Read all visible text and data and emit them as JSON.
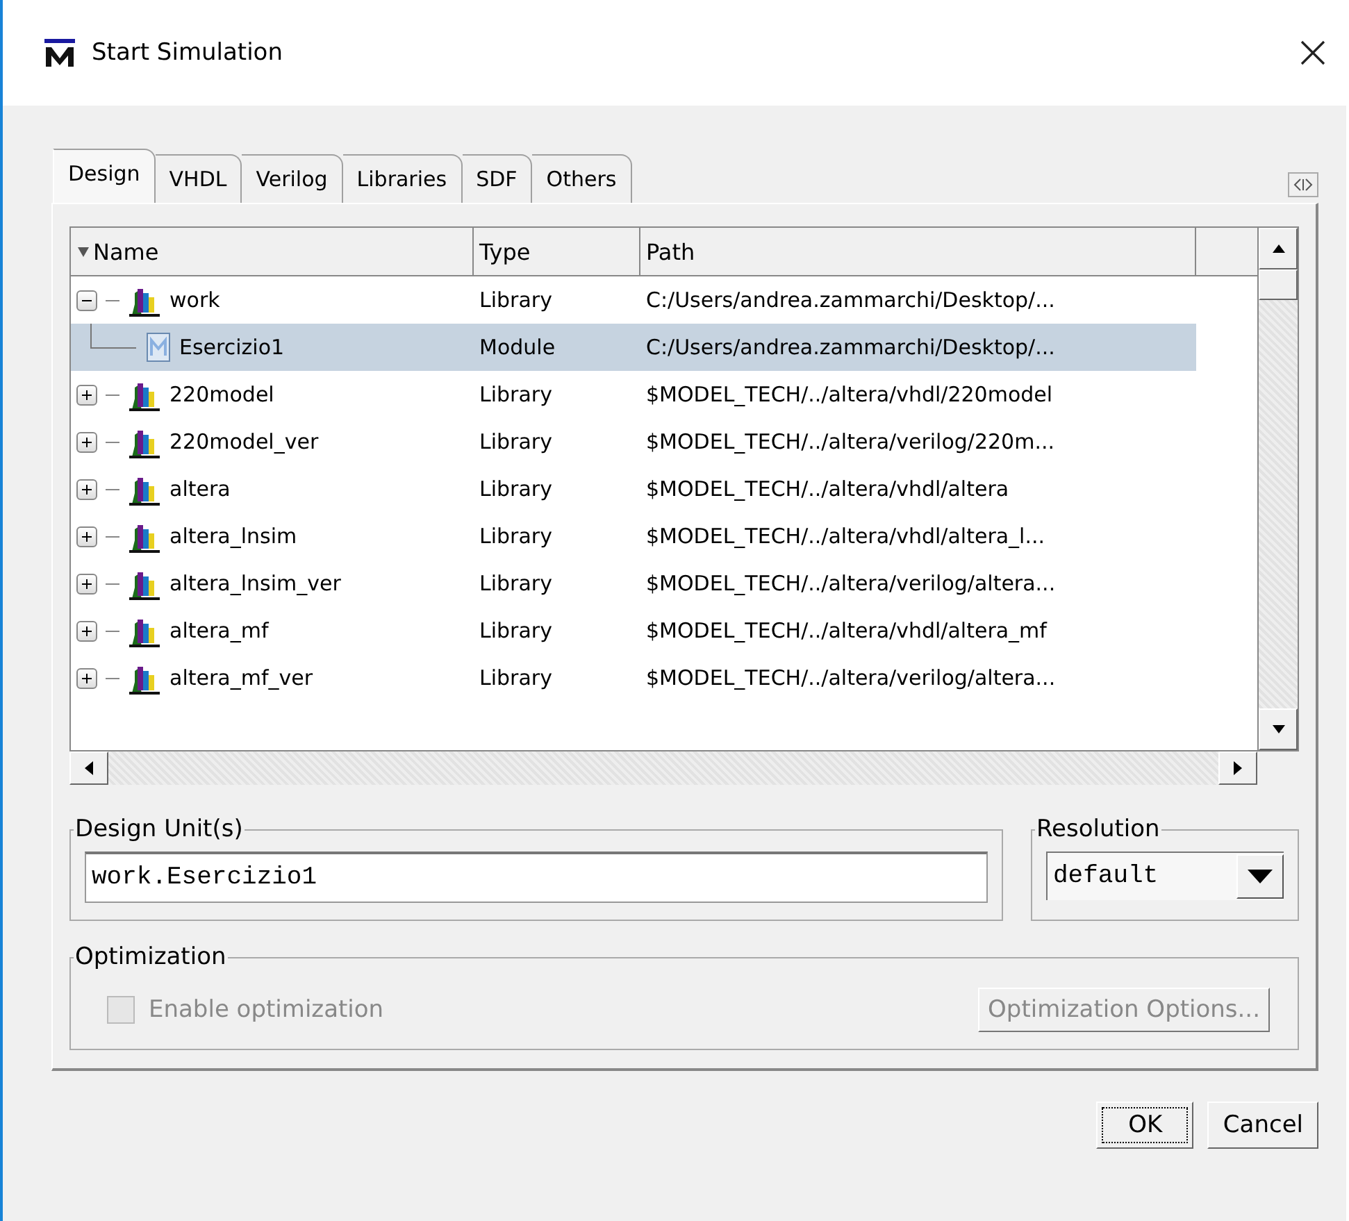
{
  "window": {
    "title": "Start Simulation"
  },
  "tabs": [
    {
      "label": "Design",
      "selected": true
    },
    {
      "label": "VHDL",
      "selected": false
    },
    {
      "label": "Verilog",
      "selected": false
    },
    {
      "label": "Libraries",
      "selected": false
    },
    {
      "label": "SDF",
      "selected": false
    },
    {
      "label": "Others",
      "selected": false
    }
  ],
  "tree": {
    "columns": [
      "Name",
      "Type",
      "Path"
    ],
    "rows": [
      {
        "kind": "library",
        "name": "work",
        "type": "Library",
        "path": "C:/Users/andrea.zammarchi/Desktop/...",
        "expanded": true,
        "selected": false,
        "children": [
          {
            "kind": "module",
            "name": "Esercizio1",
            "type": "Module",
            "path": "C:/Users/andrea.zammarchi/Desktop/...",
            "selected": true
          }
        ]
      },
      {
        "kind": "library",
        "name": "220model",
        "type": "Library",
        "path": "$MODEL_TECH/../altera/vhdl/220model",
        "expanded": false,
        "selected": false
      },
      {
        "kind": "library",
        "name": "220model_ver",
        "type": "Library",
        "path": "$MODEL_TECH/../altera/verilog/220m...",
        "expanded": false,
        "selected": false
      },
      {
        "kind": "library",
        "name": "altera",
        "type": "Library",
        "path": "$MODEL_TECH/../altera/vhdl/altera",
        "expanded": false,
        "selected": false
      },
      {
        "kind": "library",
        "name": "altera_lnsim",
        "type": "Library",
        "path": "$MODEL_TECH/../altera/vhdl/altera_l...",
        "expanded": false,
        "selected": false
      },
      {
        "kind": "library",
        "name": "altera_lnsim_ver",
        "type": "Library",
        "path": "$MODEL_TECH/../altera/verilog/altera...",
        "expanded": false,
        "selected": false
      },
      {
        "kind": "library",
        "name": "altera_mf",
        "type": "Library",
        "path": "$MODEL_TECH/../altera/vhdl/altera_mf",
        "expanded": false,
        "selected": false
      },
      {
        "kind": "library",
        "name": "altera_mf_ver",
        "type": "Library",
        "path": "$MODEL_TECH/../altera/verilog/altera...",
        "expanded": false,
        "selected": false
      }
    ]
  },
  "design_unit": {
    "label": "Design Unit(s)",
    "value": "work.Esercizio1"
  },
  "resolution": {
    "label": "Resolution",
    "value": "default"
  },
  "optimization": {
    "label": "Optimization",
    "checkbox": {
      "label": "Enable optimization",
      "checked": false,
      "disabled": true
    },
    "options_button": {
      "label": "Optimization Options...",
      "disabled": true
    }
  },
  "buttons": [
    {
      "label": "OK",
      "focused": true
    },
    {
      "label": "Cancel",
      "focused": false
    }
  ]
}
